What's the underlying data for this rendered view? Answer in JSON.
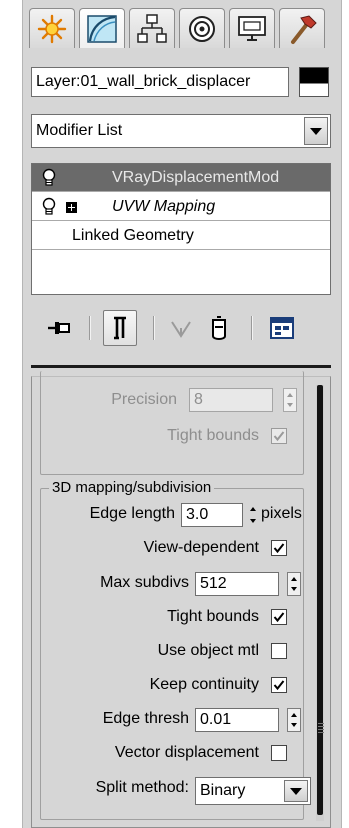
{
  "tabs": [
    {
      "icon": "create-icon",
      "active": false
    },
    {
      "icon": "modify-icon",
      "active": true
    },
    {
      "icon": "hierarchy-icon",
      "active": false
    },
    {
      "icon": "motion-icon",
      "active": false
    },
    {
      "icon": "display-icon",
      "active": false
    },
    {
      "icon": "utilities-icon",
      "active": false
    }
  ],
  "object": {
    "name": "Layer:01_wall_brick_displacer",
    "color_swatch": [
      "#000000",
      "#ffffff"
    ]
  },
  "modifier_list": {
    "value": "Modifier List"
  },
  "stack": {
    "items": [
      {
        "label": "VRayDisplacementMod",
        "selected": true,
        "has_bulb": true,
        "expandable": false
      },
      {
        "label": "UVW Mapping",
        "selected": false,
        "has_bulb": true,
        "expandable": true
      },
      {
        "label": "Linked Geometry",
        "selected": false,
        "has_bulb": false,
        "expandable": false
      }
    ]
  },
  "stack_toolbar": [
    {
      "icon": "pin-stack-icon",
      "pressed": false
    },
    {
      "icon": "show-end-result-icon",
      "pressed": true
    },
    {
      "icon": "make-unique-icon",
      "pressed": false
    },
    {
      "icon": "remove-modifier-icon",
      "pressed": false
    },
    {
      "icon": "configure-modifier-sets-icon",
      "pressed": false
    }
  ],
  "partial_group": {
    "precision": {
      "label": "Precision",
      "value": "8",
      "enabled": false
    },
    "tight_bounds": {
      "label": "Tight bounds",
      "checked": true,
      "enabled": false
    }
  },
  "group_3d": {
    "title": "3D mapping/subdivision",
    "edge_length": {
      "label": "Edge length",
      "value": "3.0",
      "unit": "pixels"
    },
    "view_dependent": {
      "label": "View-dependent",
      "checked": true
    },
    "max_subdivs": {
      "label": "Max subdivs",
      "value": "512"
    },
    "tight_bounds": {
      "label": "Tight bounds",
      "checked": true
    },
    "use_object_mtl": {
      "label": "Use object mtl",
      "checked": false
    },
    "keep_continuity": {
      "label": "Keep continuity",
      "checked": true
    },
    "edge_thresh": {
      "label": "Edge thresh",
      "value": "0.01"
    },
    "vector_displacement": {
      "label": "Vector displacement",
      "checked": false
    },
    "split_method": {
      "label": "Split method:",
      "value": "Binary"
    }
  },
  "colors": {
    "panel_bg": "#d6d6d6",
    "selected_row": "#6a6a6a",
    "scroll_thumb": "#141414"
  }
}
